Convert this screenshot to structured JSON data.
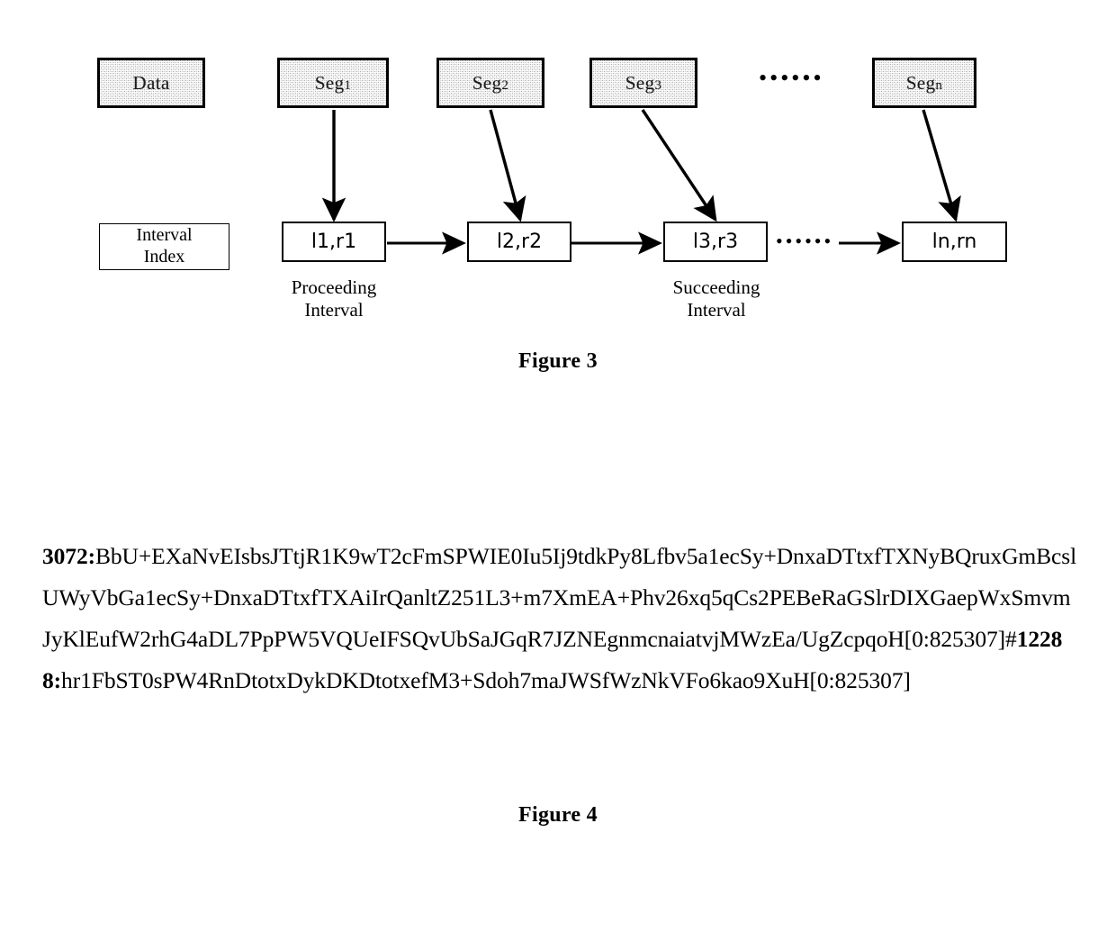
{
  "document": {
    "type": "patent-figure-sheet"
  },
  "figure3": {
    "caption": "Figure 3",
    "data_box": {
      "label": "Data"
    },
    "segments": [
      {
        "label": "Seg",
        "subscript": "1"
      },
      {
        "label": "Seg",
        "subscript": "2"
      },
      {
        "label": "Seg",
        "subscript": "3"
      },
      {
        "label": "Seg",
        "subscript": "n"
      }
    ],
    "segment_ellipsis": "••••••",
    "index_box": {
      "line1": "Interval",
      "line2": "Index"
    },
    "intervals": [
      {
        "label": "l1,r1"
      },
      {
        "label": "l2,r2"
      },
      {
        "label": "l3,r3"
      },
      {
        "label": "ln,rn"
      }
    ],
    "interval_ellipsis": "••••••",
    "annotations": [
      {
        "line1": "Proceeding",
        "line2": "Interval"
      },
      {
        "line1": "Succeeding",
        "line2": "Interval"
      }
    ]
  },
  "figure4": {
    "caption": "Figure 4",
    "hash_lines": [
      {
        "bold": "3072:",
        "text": "BbU+EXaNvEIsbsJTtjR1K9wT2cFmSPWIE0Iu5Ij9tdkPy8Lfbv5a1ecSy+DnxaDTtxfTXN"
      },
      {
        "bold": "",
        "text": "yBQruxGmBcslUWyVbGa1ecSy+DnxaDTtxfTXAiIrQanltZ251L3+m7XmEA+Phv26xq5qCs2"
      },
      {
        "bold": "",
        "text": "PEBeRaGSlrDIXGaepWxSmvmJyKlEufW2rhG4aDL7PpPW5VQUeIFSQvUbSaJGqR7JZNEgn"
      },
      {
        "bold": "",
        "text": "mcnaiatvjMWzEa/UgZcpqoH[0:825307]#"
      },
      {
        "bold": "12288:",
        "text": "hr1FbST0sPW4RnDtotxDykDKDtotxefM3+S"
      },
      {
        "bold": "",
        "text": "doh7maJWSfWzNkVFo6kao9XuH[0:825307]"
      }
    ],
    "full_text": "3072:BbU+EXaNvEIsbsJTtjR1K9wT2cFmSPWIE0Iu5Ij9tdkPy8Lfbv5a1ecSy+DnxaDTtxfTXNyBQruxGmBcslUWyVbGa1ecSy+DnxaDTtxfTXAiIrQanltZ251L3+m7XmEA+Phv26xq5qCs2PEBeRaGSlrDIXGaepWxSmvmJyKlEufW2rhG4aDL7PpPW5VQUeIFSQvUbSaJGqR7JZNEgnmcnaiatvjMWzEa/UgZcpqoH[0:825307]#12288:hr1FbST0sPW4RnDtotxDykDKDtotxefM3+Sdoh7maJWSfWzNkVFo6kao9XuH[0:825307]"
  },
  "colors": {
    "ink": "#000000",
    "paper": "#ffffff",
    "segment_fill": "#d4d4d4"
  }
}
